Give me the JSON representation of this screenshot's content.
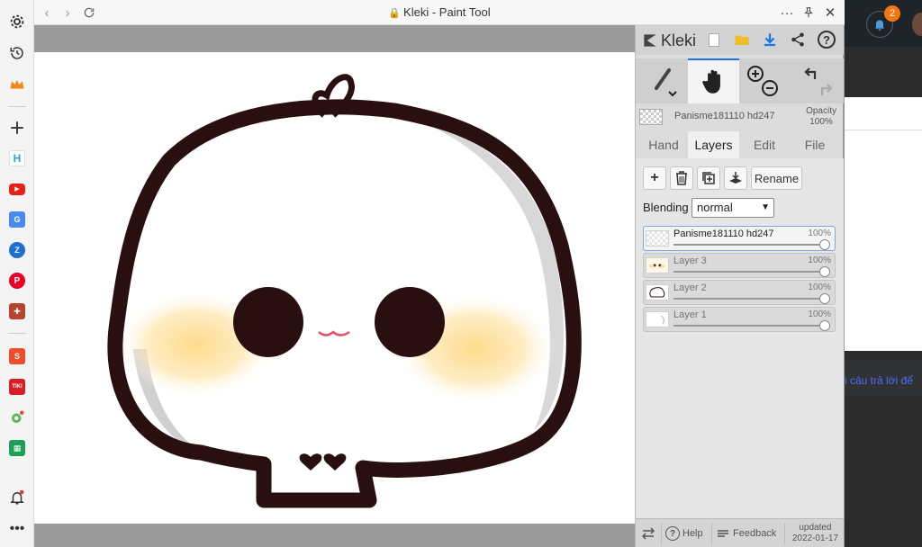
{
  "window": {
    "title": "Kleki - Paint Tool"
  },
  "left_sidebar": {
    "icons": [
      "settings-icon",
      "history-icon",
      "crown-icon",
      "add-icon",
      "app-h-icon",
      "youtube-icon",
      "translate-icon",
      "app-blue-icon",
      "pinterest-icon",
      "shield-app-icon",
      "shopee-icon",
      "tiki-icon",
      "wheel-icon",
      "sheets-icon",
      "notifications-icon",
      "more-icon"
    ],
    "shopee_label": "S",
    "tiki_label": "TIKI"
  },
  "panel": {
    "logo": "Kleki",
    "current_layer_name": "Panisme181110 hd247",
    "opacity_label": "Opacity",
    "opacity_value": "100%",
    "tabs": [
      {
        "label": "Hand"
      },
      {
        "label": "Layers"
      },
      {
        "label": "Edit"
      },
      {
        "label": "File"
      }
    ],
    "active_tab": "Layers",
    "rename_label": "Rename",
    "blending_label": "Blending",
    "blending_value": "normal",
    "layers": [
      {
        "name": "Panisme181110 hd247",
        "opacity": "100%",
        "active": true
      },
      {
        "name": "Layer 3",
        "opacity": "100%",
        "active": false
      },
      {
        "name": "Layer 2",
        "opacity": "100%",
        "active": false
      },
      {
        "name": "Layer 1",
        "opacity": "100%",
        "active": false
      }
    ],
    "footer": {
      "help": "Help",
      "feedback": "Feedback",
      "updated_label": "updated",
      "updated_date": "2022-01-17"
    }
  },
  "background_page": {
    "notification_count": "2",
    "snippet": "i câu trả lời để"
  },
  "colors": {
    "canvas_bg": "#9b9b9b",
    "panel_bg": "#dcdcdc",
    "accent_blue": "#1a73e8",
    "badge_orange": "#f4760f",
    "outline": "#2a0f10",
    "cheek": "#ffe2a0"
  }
}
